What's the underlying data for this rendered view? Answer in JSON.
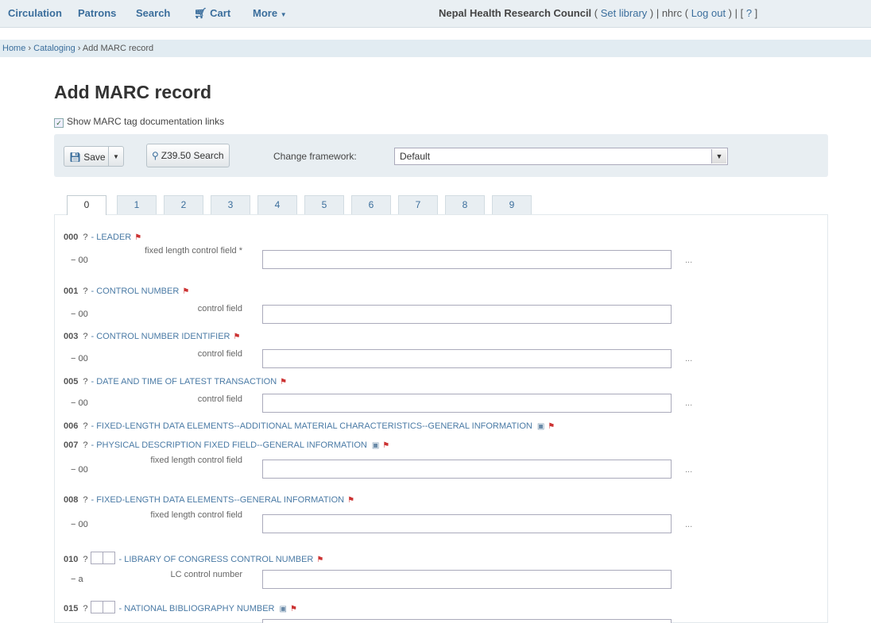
{
  "nav": {
    "circulation": "Circulation",
    "patrons": "Patrons",
    "search": "Search",
    "cart": "Cart",
    "more": "More",
    "library_name": "Nepal Health Research Council",
    "set_library": "Set library",
    "user": "nhrc",
    "logout": "Log out",
    "help": "?"
  },
  "breadcrumb": {
    "home": "Home",
    "cataloging": "Cataloging",
    "current": "Add MARC record"
  },
  "page": {
    "title": "Add MARC record",
    "show_doc_label": "Show MARC tag documentation links"
  },
  "toolbar": {
    "save_label": "Save",
    "z3950_label": "Z39.50 Search",
    "framework_label": "Change framework:",
    "framework_value": "Default"
  },
  "tabs": [
    "0",
    "1",
    "2",
    "3",
    "4",
    "5",
    "6",
    "7",
    "8",
    "9"
  ],
  "fields": [
    {
      "tag": "000",
      "name": "- LEADER",
      "sub": {
        "code": "00",
        "label": "fixed length control field *",
        "plugin": "..."
      }
    },
    {
      "tag": "001",
      "name": "- CONTROL NUMBER",
      "sub": {
        "code": "00",
        "label": "control field",
        "plugin": ""
      }
    },
    {
      "tag": "003",
      "name": "- CONTROL NUMBER IDENTIFIER",
      "sub": {
        "code": "00",
        "label": "control field",
        "plugin": "..."
      }
    },
    {
      "tag": "005",
      "name": "- DATE AND TIME OF LATEST TRANSACTION",
      "sub": {
        "code": "00",
        "label": "control field",
        "plugin": "..."
      }
    },
    {
      "tag": "006",
      "name": "- FIXED-LENGTH DATA ELEMENTS--ADDITIONAL MATERIAL CHARACTERISTICS--GENERAL INFORMATION"
    },
    {
      "tag": "007",
      "name": "- PHYSICAL DESCRIPTION FIXED FIELD--GENERAL INFORMATION",
      "sub": {
        "code": "00",
        "label": "fixed length control field",
        "plugin": "..."
      }
    },
    {
      "tag": "008",
      "name": "- FIXED-LENGTH DATA ELEMENTS--GENERAL INFORMATION",
      "sub": {
        "code": "00",
        "label": "fixed length control field",
        "plugin": "..."
      }
    },
    {
      "tag": "010",
      "name": "- LIBRARY OF CONGRESS CONTROL NUMBER",
      "sub": {
        "code": "a",
        "label": "LC control number",
        "plugin": ""
      }
    },
    {
      "tag": "015",
      "name": "- NATIONAL BIBLIOGRAPHY NUMBER"
    }
  ],
  "colors": {
    "accent": "#3b6e9c",
    "toolbar": "#e8eef2",
    "flag": "#cc3333"
  }
}
